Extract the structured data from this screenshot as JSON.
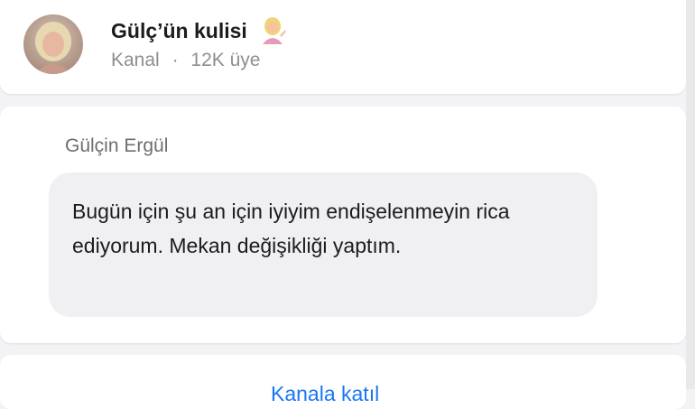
{
  "channel": {
    "name": "Gülç’ün kulisi",
    "emoji_icon": "woman-tipping-hand-emoji",
    "type_label": "Kanal",
    "separator": "·",
    "member_count": "12K üye",
    "avatar_icon": "channel-avatar"
  },
  "message": {
    "sender": "Gülçin Ergül",
    "text": "Bugün için şu an için iyiyim endişelenmeyin rica ediyorum. Mekan değişikliği yaptım."
  },
  "footer": {
    "action_label": "Kanala katıl"
  },
  "colors": {
    "background": "#f3f3f5",
    "card": "#ffffff",
    "bubble": "#f0f0f2",
    "link": "#1877f2",
    "secondary_text": "#8e8e93"
  }
}
